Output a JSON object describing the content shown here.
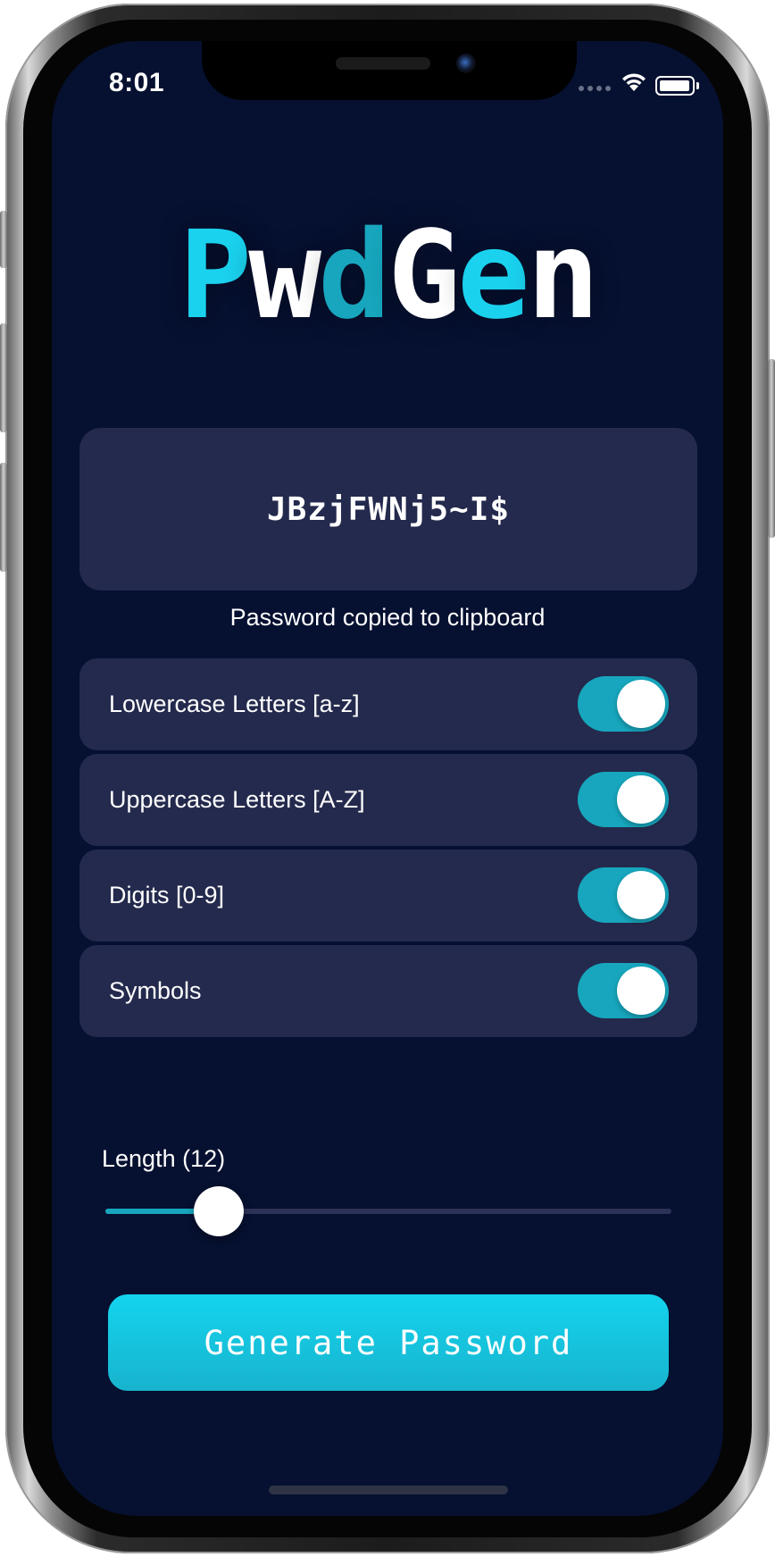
{
  "status_bar": {
    "time": "8:01"
  },
  "app": {
    "logo": [
      {
        "char": "P",
        "color": "#1ad2ee"
      },
      {
        "char": "w",
        "color": "#ffffff"
      },
      {
        "char": "d",
        "color": "#17a6bd"
      },
      {
        "char": "G",
        "color": "#ffffff"
      },
      {
        "char": "e",
        "color": "#1ad2ee"
      },
      {
        "char": "n",
        "color": "#ffffff"
      }
    ]
  },
  "password": {
    "value": "JBzjFWNj5~I$",
    "status": "Password copied to clipboard"
  },
  "options": [
    {
      "label": "Lowercase Letters [a-z]",
      "enabled": true
    },
    {
      "label": "Uppercase Letters [A-Z]",
      "enabled": true
    },
    {
      "label": "Digits [0-9]",
      "enabled": true
    },
    {
      "label": "Symbols",
      "enabled": true
    }
  ],
  "length": {
    "label": "Length (12)",
    "value": 12,
    "slider_fraction": 0.2
  },
  "generate_button": {
    "label": "Generate Password"
  },
  "colors": {
    "background": "#061030",
    "card": "#242a4d",
    "accent": "#17a6bd",
    "accent_bright": "#1ad2ee"
  }
}
